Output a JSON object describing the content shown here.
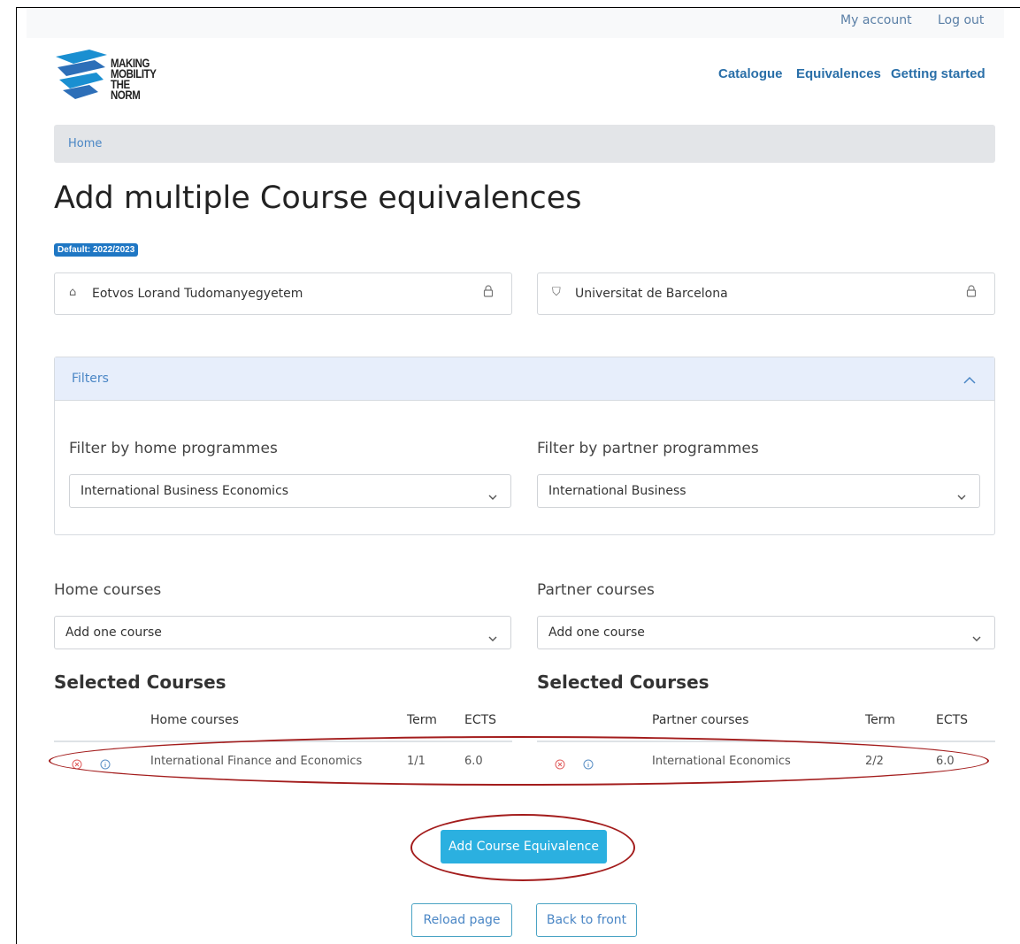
{
  "topbar": {
    "my_account": "My account",
    "log_out": "Log out"
  },
  "logo": {
    "line1": "MAKING",
    "line2": "MOBILITY",
    "line3": "THE NORM"
  },
  "nav": {
    "catalogue": "Catalogue",
    "equivalences": "Equivalences",
    "getting_started": "Getting started"
  },
  "breadcrumb": {
    "home": "Home"
  },
  "page": {
    "title": "Add multiple Course equivalences",
    "badge": "Default: 2022/2023"
  },
  "universities": {
    "home": "Eotvos Lorand Tudomanyegyetem",
    "partner": "Universitat de Barcelona"
  },
  "filters": {
    "title": "Filters",
    "home_label": "Filter by home programmes",
    "home_value": "International Business Economics",
    "partner_label": "Filter by partner programmes",
    "partner_value": "International Business"
  },
  "courses": {
    "home_label": "Home courses",
    "home_placeholder": "Add one course",
    "partner_label": "Partner courses",
    "partner_placeholder": "Add one course"
  },
  "selected": {
    "home_heading": "Selected Courses",
    "partner_heading": "Selected Courses",
    "home_columns": {
      "course": "Home courses",
      "term": "Term",
      "ects": "ECTS"
    },
    "partner_columns": {
      "course": "Partner courses",
      "term": "Term",
      "ects": "ECTS"
    },
    "home_row": {
      "course": "International Finance and Economics",
      "term": "1/1",
      "ects": "6.0"
    },
    "partner_row": {
      "course": "International Economics",
      "term": "2/2",
      "ects": "6.0"
    }
  },
  "actions": {
    "add": "Add Course Equivalence",
    "reload": "Reload page",
    "back": "Back to front"
  },
  "colors": {
    "accent": "#2bb0e0",
    "link": "#2a6fa8",
    "annotation": "#a31c1c",
    "badge": "#1f77c4"
  }
}
